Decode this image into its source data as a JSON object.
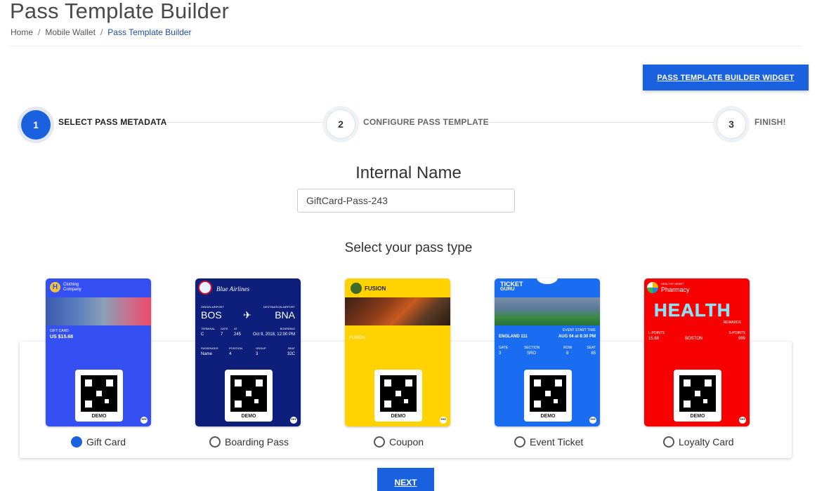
{
  "header": {
    "title": "Pass Template Builder",
    "breadcrumb": [
      "Home",
      "Mobile Wallet",
      "Pass Template Builder"
    ]
  },
  "widget_button": "PASS TEMPLATE BUILDER WIDGET",
  "steps": [
    {
      "number": "1",
      "label": "SELECT PASS METADATA",
      "active": true
    },
    {
      "number": "2",
      "label": "CONFIGURE PASS TEMPLATE",
      "active": false
    },
    {
      "number": "3",
      "label": "FINISH!",
      "active": false
    }
  ],
  "internal_name": {
    "label": "Internal Name",
    "value": "GiftCard-Pass-243"
  },
  "select_type_label": "Select your pass type",
  "pass_types": [
    {
      "label": "Gift Card",
      "selected": true
    },
    {
      "label": "Boarding Pass",
      "selected": false
    },
    {
      "label": "Coupon",
      "selected": false
    },
    {
      "label": "Event Ticket",
      "selected": false
    },
    {
      "label": "Loyalty Card",
      "selected": false
    }
  ],
  "cards": {
    "gift": {
      "brand": "Clothing\nCompany",
      "brand_line1": "Clothing",
      "brand_line2": "Company",
      "logo": "H",
      "field_label": "GIFT CARD",
      "field_value": "US $15.68",
      "color": "#3550f2"
    },
    "boarding": {
      "brand": "Blue Airlines",
      "origin_label": "ORIGIN AIRPORT",
      "dest_label": "DESTINATION AIRPORT",
      "origin": "BOS",
      "dest": "BNA",
      "terminal_label": "TERMINAL",
      "terminal": "C",
      "gate_label": "GATE",
      "gate": "7",
      "at_label": "AT",
      "at": "245",
      "boarding_label": "BOARDING",
      "boarding": "Oct 9, 2018, 12:00 PM",
      "passenger_label": "PASSENGER",
      "passenger": "Name",
      "position_label": "POSITION",
      "position": "4",
      "group_label": "GROUP",
      "group": "3",
      "seat_label": "SEAT",
      "seat": "32C",
      "color": "#0d1f7a"
    },
    "coupon": {
      "brand": "FUSION",
      "field": "FUSION",
      "color": "#ffd200"
    },
    "event": {
      "brand_line1": "TICKET",
      "brand_line2": "GURU",
      "start_label": "EVENT START TIME",
      "event_name": "ENGLAND 111",
      "start": "AUG 04 at 8:30 PM",
      "gate_label": "GATE",
      "gate": "3",
      "section_label": "SECTION",
      "section": "SRO",
      "row_label": "ROW",
      "row": "8",
      "seat_label": "SEAT",
      "seat": "85",
      "color": "#1a6df0"
    },
    "loyalty": {
      "brand_small": "HEALTHY HEART",
      "brand": "Pharmacy",
      "banner": "HEALTH",
      "banner_sub": "REWARDS",
      "lpoints_label": "L-POINTS",
      "lpoints": "15.68",
      "city": "BOSTON",
      "spoints_label": "S-POINTS",
      "spoints": "999",
      "color": "#f70000"
    },
    "demo": "DEMO"
  },
  "next_button": "NEXT",
  "colors": {
    "primary": "#1a61e0"
  }
}
